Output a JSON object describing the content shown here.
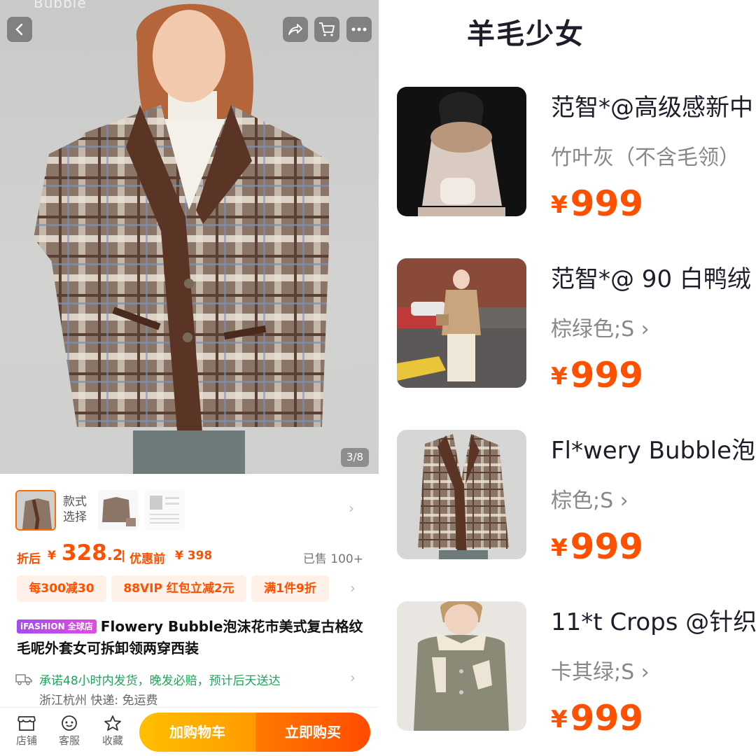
{
  "product": {
    "watermark": "Bubble",
    "image_counter": "3/8",
    "styles_label": "款式\n选择",
    "price_label": "折后",
    "currency": "¥",
    "price_integer": "328",
    "price_decimal": ".2",
    "divider": "|",
    "original_label": "优惠前",
    "original_price": "¥ 398",
    "sold": "已售 100+",
    "coupons": [
      "每300减30",
      "88VIP 红包立减2元",
      "满1件9折"
    ],
    "badge": "iFASHION 全球店",
    "title": "Flowery Bubble泡沫花市美式复古格纹毛呢外套女可拆卸领两穿西装",
    "shipping_promise": "承诺48小时内发货，晚发必赔，预计后天送达",
    "shipping_location": "浙江杭州  快递: 免运费"
  },
  "bottom_bar": {
    "shop": "店铺",
    "service": "客服",
    "favorite": "收藏",
    "add_to_cart": "加购物车",
    "buy_now": "立即购买"
  },
  "list": {
    "title": "羊毛少女",
    "items": [
      {
        "name": "范智*@高级感新中",
        "sku": "竹叶灰（不含毛领）",
        "currency": "¥",
        "price": "999"
      },
      {
        "name": "范智*@ 90 白鸭绒",
        "sku": "棕绿色;S ›",
        "currency": "¥",
        "price": "999"
      },
      {
        "name": "Fl*wery Bubble泡",
        "sku": "棕色;S ›",
        "currency": "¥",
        "price": "999"
      },
      {
        "name": "11*t Crops @针织",
        "sku": "卡其绿;S ›",
        "currency": "¥",
        "price": "999"
      }
    ]
  },
  "colors": {
    "accent": "#ff5000",
    "green": "#1fa35b"
  }
}
